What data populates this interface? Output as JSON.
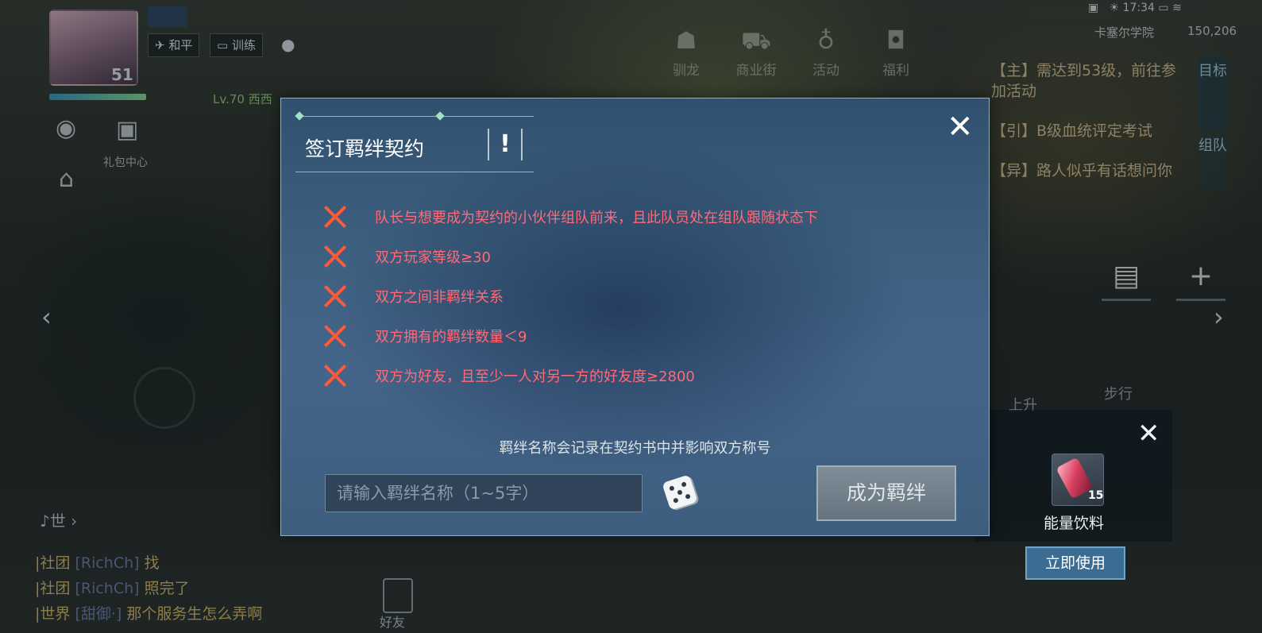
{
  "hud": {
    "avatar_level": "51",
    "mode_peace": "和平",
    "mode_train": "训练",
    "player_level_tag": "Lv.70 西西",
    "gift_center": "礼包中心",
    "time": "17:34",
    "location": "卡塞尔学院",
    "coordinates": "150,206",
    "menu": [
      "驯龙",
      "商业街",
      "活动",
      "福利"
    ],
    "quests": [
      "【主】需达到53级，前往参加活动",
      "【引】B级血统评定考试",
      "【异】路人似乎有话想问你"
    ],
    "side_tabs": [
      "目标",
      "组队"
    ],
    "move_up": "上升",
    "move_walk": "步行",
    "chat_channel_label": "世",
    "chat": [
      {
        "channel": "|社团",
        "user": "[RichCh]",
        "message": "找"
      },
      {
        "channel": "|社团",
        "user": "[RichCh]",
        "message": "照完了"
      },
      {
        "channel": "|世界",
        "user": "[甜御·]",
        "message": "那个服务生怎么弄啊"
      }
    ],
    "friend_label": "好友",
    "item": {
      "name": "能量饮料",
      "quantity": "15",
      "use_label": "立即使用"
    }
  },
  "dialog": {
    "title": "签订羁绊契约",
    "conditions": [
      "队长与想要成为契约的小伙伴组队前来，且此队员处在组队跟随状态下",
      "双方玩家等级≥30",
      "双方之间非羁绊关系",
      "双方拥有的羁绊数量＜9",
      "双方为好友，且至少一人对另一方的好友度≥2800"
    ],
    "notice": "羁绊名称会记录在契约书中并影响双方称号",
    "input_placeholder": "请输入羁绊名称（1~5字）",
    "confirm_label": "成为羁绊"
  },
  "colors": {
    "condition_fail": "#ff5a38",
    "condition_text": "#ff6a78",
    "use_button": "#3d6c93"
  }
}
